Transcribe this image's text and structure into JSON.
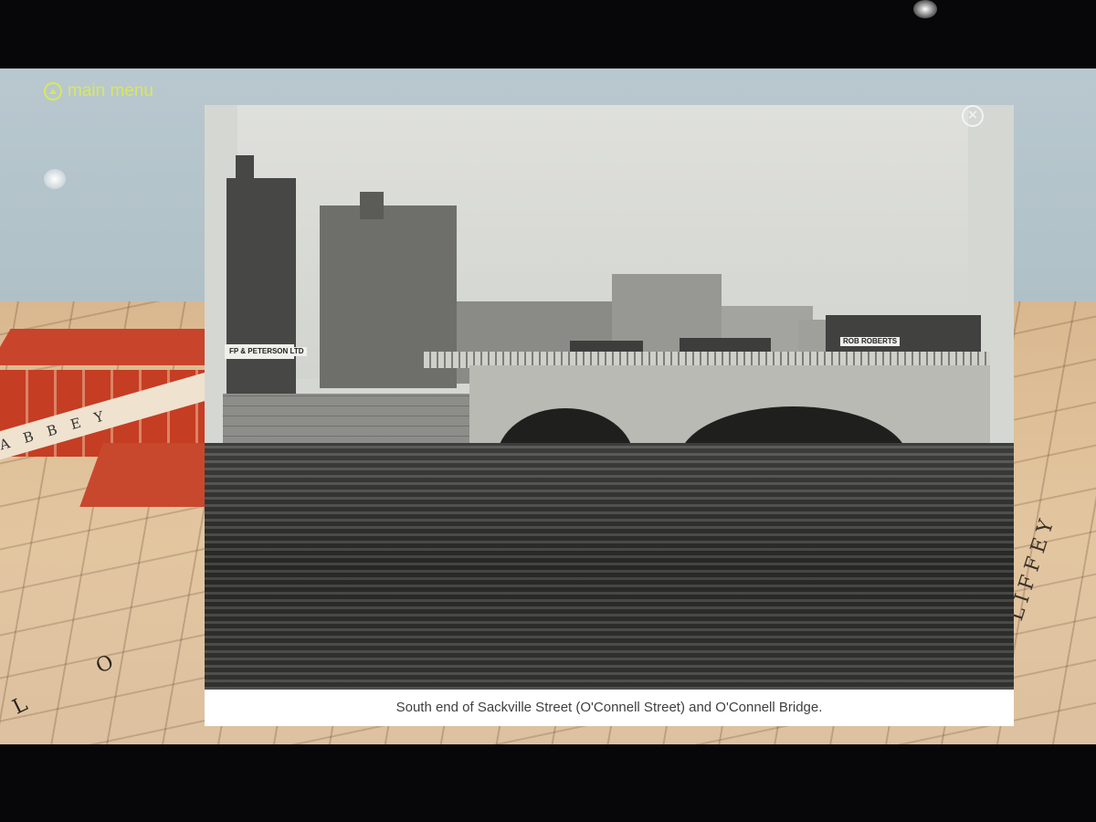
{
  "nav": {
    "main_menu_label": "main menu",
    "main_menu_icon": "up-arrow-circle-icon",
    "close_icon": "close-icon",
    "close_glyph": "✕"
  },
  "photo": {
    "caption": "South end of Sackville Street (O'Connell Street) and O'Connell Bridge.",
    "signs": {
      "shop_sign": "FP & PETERSON LTD",
      "tram_sign": "ROB ROBERTS"
    }
  },
  "map": {
    "street_label": "ABBEY",
    "street_label_2": "L O",
    "river_label": "LIFFEY"
  },
  "colors": {
    "accent": "#d8e85a",
    "map_red": "#c53d23",
    "map_paper": "#e3c6a0"
  }
}
